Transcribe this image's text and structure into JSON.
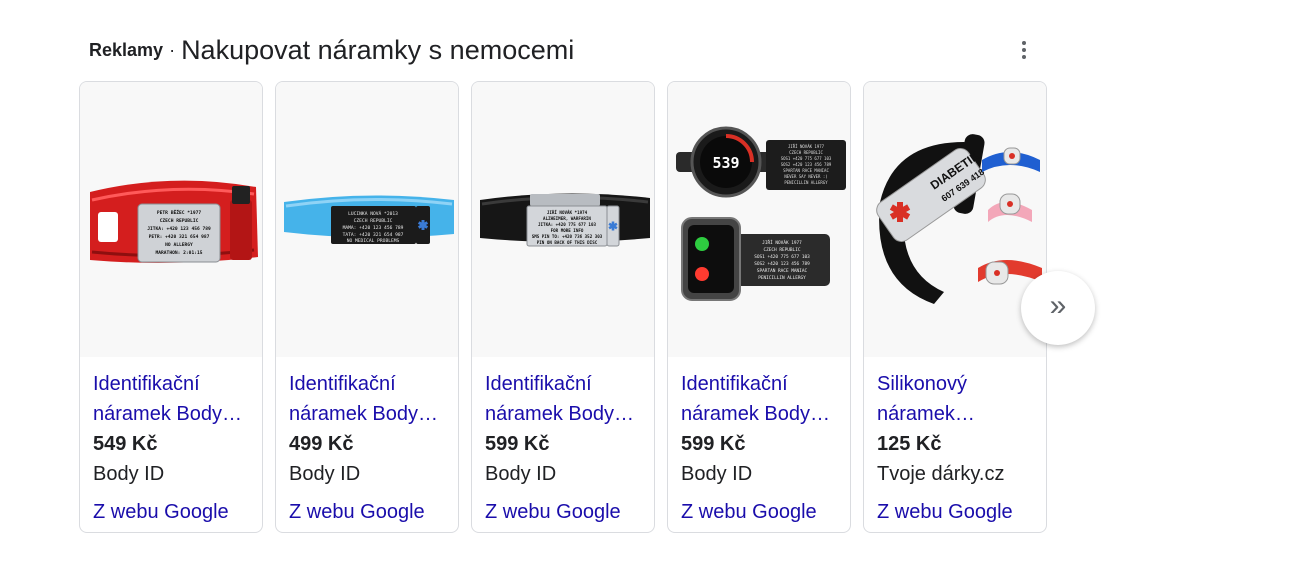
{
  "section": {
    "ads_label": "Reklamy",
    "separator": "·",
    "title": "Nakupovat náramky s nemocemi"
  },
  "products": [
    {
      "title_line1": "Identifikační",
      "title_line2": "náramek Body…",
      "price": "549 Kč",
      "seller": "Body ID",
      "source": "Z webu Google",
      "image_icon": "red-velcro-id-bracelet",
      "engraving": [
        "PETR BĚŽEC *1977",
        "CZECH REPUBLIC",
        "JITKA: +420 123 456 789",
        "PETR: +420 321 654 987",
        "NO ALLERGY",
        "MARATHON: 2:01:15"
      ]
    },
    {
      "title_line1": "Identifikační",
      "title_line2": "náramek Body…",
      "price": "499 Kč",
      "seller": "Body ID",
      "source": "Z webu Google",
      "image_icon": "blue-silicone-id-bracelet",
      "engraving": [
        "LUCINKA NOVÁ *2013",
        "CZECH REPUBLIC",
        "MAMA: +420 123 456 789",
        "TATA: +420 321 654 987",
        "NO MEDICAL PROBLEMS"
      ]
    },
    {
      "title_line1": "Identifikační",
      "title_line2": "náramek Body…",
      "price": "599 Kč",
      "seller": "Body ID",
      "source": "Z webu Google",
      "image_icon": "black-silicone-id-bracelet",
      "engraving": [
        "JIŘÍ NOVÁK *1974",
        "ALZHEIMER, WARFARIN",
        "JITKA: +420 775 677 103",
        "FOR MORE INFO",
        "SMS PIN TO: +420 736 352 303",
        "PIN ON BACK OF THIS DISC"
      ]
    },
    {
      "title_line1": "Identifikační",
      "title_line2": "náramek Body…",
      "price": "599 Kč",
      "seller": "Body ID",
      "source": "Z webu Google",
      "image_icon": "smartwatch-id-band",
      "watch_digits": "539",
      "engraving": [
        "JIŘÍ NOVÁK 1977",
        "CZECH REPUBLIC",
        "SOS1 +420 775 677 103",
        "SOS2 +420 123 456 789",
        "SPARTAN RACE MANIAC",
        "NEVER SAY NEVER :)",
        "PENICILLIN ALLERGY"
      ]
    },
    {
      "title_line1": "Silikonový",
      "title_line2": "náramek…",
      "price": "125 Kč",
      "seller": "Tvoje dárky.cz",
      "source": "Z webu Google",
      "image_icon": "diabetic-medical-bracelet",
      "engraving": [
        "DIABETIK",
        "607 639 418"
      ]
    }
  ],
  "controls": {
    "more_icon": "more-vert-icon",
    "next_icon": "double-chevron-right-icon",
    "next_glyph": "»"
  },
  "colors": {
    "link": "#1a0dab",
    "text": "#202124",
    "border": "#dadce0",
    "medical_red": "#d93025"
  }
}
